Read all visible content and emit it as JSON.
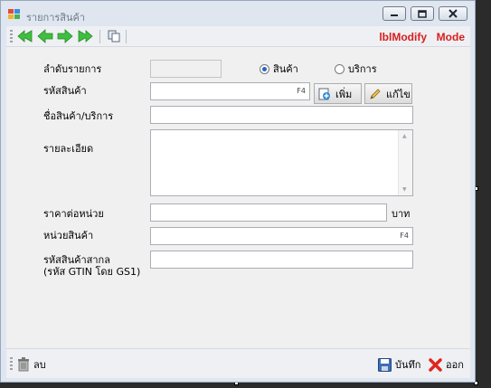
{
  "window": {
    "title": "รายการสินค้า"
  },
  "toolbar": {
    "nav_buttons": [
      "first-icon",
      "previous-icon",
      "next-icon",
      "last-icon"
    ],
    "copy_icon": "copy-icon",
    "modify_label": "lblModify",
    "mode_label": "Mode"
  },
  "form": {
    "seq_label": "ลำดับรายการ",
    "seq_value": "",
    "type_options": [
      {
        "label": "สินค้า",
        "selected": true
      },
      {
        "label": "บริการ",
        "selected": false
      }
    ],
    "code_label": "รหัสสินค้า",
    "code_value": "",
    "code_hint": "F4",
    "add_button": "เพิ่ม",
    "edit_button": "แก้ไข",
    "name_label": "ชื่อสินค้า/บริการ",
    "name_value": "",
    "detail_label": "รายละเอียด",
    "detail_value": "",
    "price_label": "ราคาต่อหน่วย",
    "price_value": "",
    "currency": "บาท",
    "unit_label": "หน่วยสินค้า",
    "unit_value": "",
    "unit_hint": "F4",
    "gtin_label_line1": "รหัสสินค้าสากล",
    "gtin_label_line2": "(รหัส GTIN โดย GS1)",
    "gtin_value": ""
  },
  "bottom": {
    "delete_label": "ลบ",
    "save_label": "บันทึก",
    "exit_label": "ออก"
  },
  "colors": {
    "mode_text": "#d81e1e",
    "nav_arrow": "#3fbf3f",
    "radio_dot": "#2a62c9",
    "exit_icon": "#e0261e"
  }
}
